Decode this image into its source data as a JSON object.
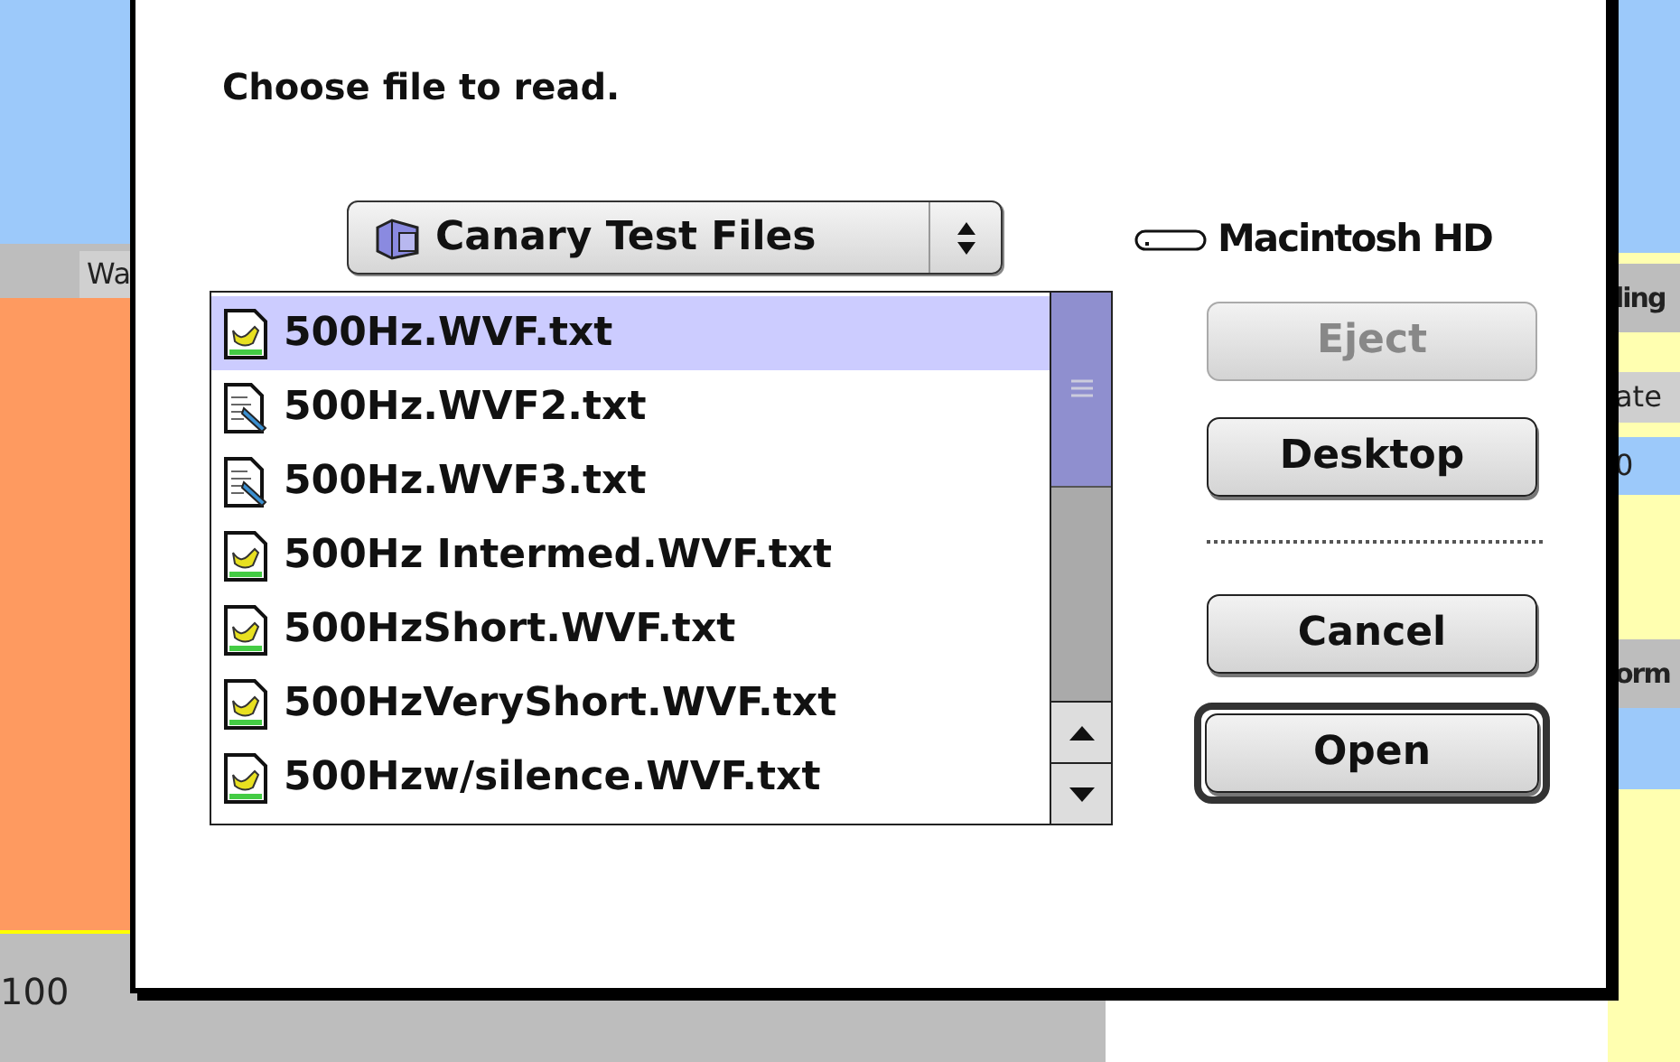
{
  "background": {
    "left_tab": "Wa",
    "left_axis_label": "100",
    "right_labels": [
      {
        "text": "ling",
        "kind": "header"
      },
      {
        "text": "ate",
        "kind": "column"
      },
      {
        "text": "0",
        "kind": "value"
      },
      {
        "text": "orm",
        "kind": "header"
      }
    ]
  },
  "dialog": {
    "prompt": "Choose file to read.",
    "folder_popup": {
      "label": "Canary Test Files"
    },
    "files": [
      {
        "name": "500Hz.WVF.txt",
        "kind": "app",
        "selected": true
      },
      {
        "name": "500Hz.WVF2.txt",
        "kind": "doc",
        "selected": false
      },
      {
        "name": "500Hz.WVF3.txt",
        "kind": "doc",
        "selected": false
      },
      {
        "name": "500Hz Intermed.WVF.txt",
        "kind": "app",
        "selected": false
      },
      {
        "name": "500HzShort.WVF.txt",
        "kind": "app",
        "selected": false
      },
      {
        "name": "500HzVeryShort.WVF.txt",
        "kind": "app",
        "selected": false
      },
      {
        "name": "500Hzw/silence.WVF.txt",
        "kind": "app",
        "selected": false
      }
    ],
    "volume": {
      "label": "Macintosh HD"
    },
    "buttons": [
      {
        "label": "Eject",
        "disabled": true,
        "default": false,
        "kind": "button"
      },
      {
        "label": "Desktop",
        "disabled": false,
        "default": false,
        "kind": "button"
      },
      {
        "kind": "separator"
      },
      {
        "label": "Cancel",
        "disabled": false,
        "default": false,
        "kind": "button"
      },
      {
        "label": "Open",
        "disabled": false,
        "default": true,
        "kind": "button"
      }
    ]
  }
}
